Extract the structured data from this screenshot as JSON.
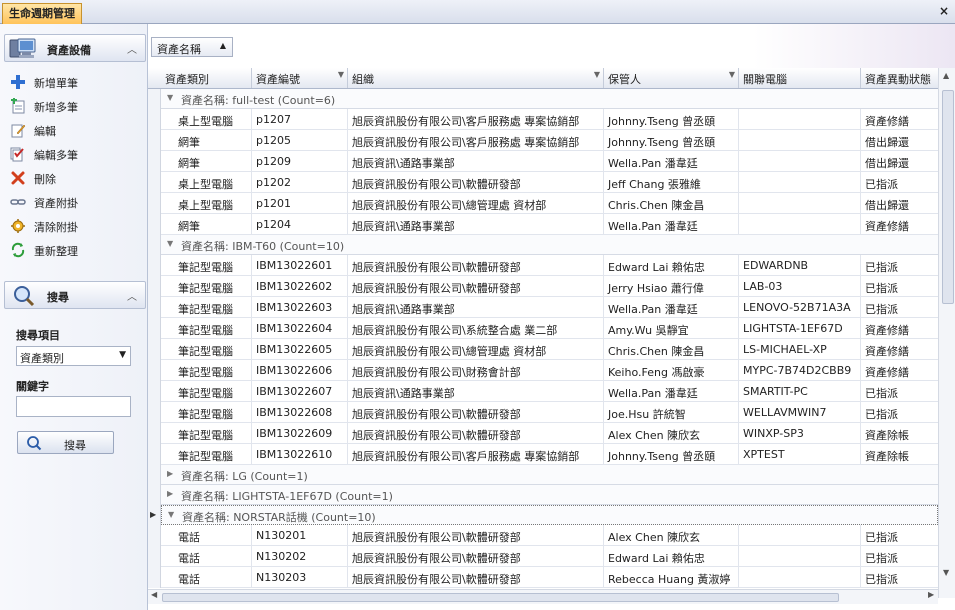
{
  "tab": {
    "label": "生命週期管理",
    "close": "×"
  },
  "sidebar": {
    "group_title": "資產設備",
    "items": [
      {
        "label": "新增單筆",
        "icon": "plus-icon"
      },
      {
        "label": "新增多筆",
        "icon": "add-multiple-icon"
      },
      {
        "label": "編輯",
        "icon": "edit-icon"
      },
      {
        "label": "編輯多筆",
        "icon": "edit-multiple-icon"
      },
      {
        "label": "刪除",
        "icon": "delete-icon"
      },
      {
        "label": "資產附掛",
        "icon": "attach-icon"
      },
      {
        "label": "清除附掛",
        "icon": "detach-icon"
      },
      {
        "label": "重新整理",
        "icon": "refresh-icon"
      }
    ],
    "search_title": "搜尋",
    "search_item_label": "搜尋項目",
    "search_item_value": "資產類別",
    "keyword_label": "關鍵字",
    "keyword_value": "",
    "search_button": "搜尋"
  },
  "group_chip": {
    "label": "資產名稱",
    "arrow": "▲"
  },
  "columns": [
    "資產類別",
    "資產編號",
    "組織",
    "保管人",
    "關聯電腦",
    "資產異動狀態"
  ],
  "groups": [
    {
      "title": "資產名稱: full-test (Count=6)",
      "expanded": true,
      "rows": [
        [
          "桌上型電腦",
          "p1207",
          "旭辰資訊股份有限公司\\客戶服務處 專案協銷部",
          "Johnny.Tseng 曾丞頤",
          "",
          "資產修繕"
        ],
        [
          "網筆",
          "p1205",
          "旭辰資訊股份有限公司\\客戶服務處 專案協銷部",
          "Johnny.Tseng 曾丞頤",
          "",
          "借出歸還"
        ],
        [
          "網筆",
          "p1209",
          "旭辰資訊\\通路事業部",
          "Wella.Pan 潘韋廷",
          "",
          "借出歸還"
        ],
        [
          "桌上型電腦",
          "p1202",
          "旭辰資訊股份有限公司\\軟體研發部",
          "Jeff Chang 張雅維",
          "",
          "已指派"
        ],
        [
          "桌上型電腦",
          "p1201",
          "旭辰資訊股份有限公司\\總管理處 資材部",
          "Chris.Chen 陳金昌",
          "",
          "借出歸還"
        ],
        [
          "網筆",
          "p1204",
          "旭辰資訊\\通路事業部",
          "Wella.Pan 潘韋廷",
          "",
          "資產修繕"
        ]
      ]
    },
    {
      "title": "資產名稱: IBM-T60 (Count=10)",
      "expanded": true,
      "rows": [
        [
          "筆記型電腦",
          "IBM13022601",
          "旭辰資訊股份有限公司\\軟體研發部",
          "Edward Lai 賴佑忠",
          "EDWARDNB",
          "已指派"
        ],
        [
          "筆記型電腦",
          "IBM13022602",
          "旭辰資訊股份有限公司\\軟體研發部",
          "Jerry Hsiao 蕭行偉",
          "LAB-03",
          "已指派"
        ],
        [
          "筆記型電腦",
          "IBM13022603",
          "旭辰資訊\\通路事業部",
          "Wella.Pan 潘韋廷",
          "LENOVO-52B71A3A",
          "已指派"
        ],
        [
          "筆記型電腦",
          "IBM13022604",
          "旭辰資訊股份有限公司\\系統整合處 業二部",
          "Amy.Wu 吳靜宜",
          "LIGHTSTA-1EF67D",
          "資產修繕"
        ],
        [
          "筆記型電腦",
          "IBM13022605",
          "旭辰資訊股份有限公司\\總管理處 資材部",
          "Chris.Chen 陳金昌",
          "LS-MICHAEL-XP",
          "資產修繕"
        ],
        [
          "筆記型電腦",
          "IBM13022606",
          "旭辰資訊股份有限公司\\財務會計部",
          "Keiho.Feng 馮啟豪",
          "MYPC-7B74D2CBB9",
          "資產修繕"
        ],
        [
          "筆記型電腦",
          "IBM13022607",
          "旭辰資訊\\通路事業部",
          "Wella.Pan 潘韋廷",
          "SMARTIT-PC",
          "已指派"
        ],
        [
          "筆記型電腦",
          "IBM13022608",
          "旭辰資訊股份有限公司\\軟體研發部",
          "Joe.Hsu 許統智",
          "WELLAVMWIN7",
          "已指派"
        ],
        [
          "筆記型電腦",
          "IBM13022609",
          "旭辰資訊股份有限公司\\軟體研發部",
          "Alex Chen 陳欣玄",
          "WINXP-SP3",
          "資產除帳"
        ],
        [
          "筆記型電腦",
          "IBM13022610",
          "旭辰資訊股份有限公司\\客戶服務處 專案協銷部",
          "Johnny.Tseng 曾丞頤",
          "XPTEST",
          "資產除帳"
        ]
      ]
    },
    {
      "title": "資產名稱: LG (Count=1)",
      "expanded": false,
      "rows": []
    },
    {
      "title": "資產名稱: LIGHTSTA-1EF67D (Count=1)",
      "expanded": false,
      "rows": []
    },
    {
      "title": "資產名稱: NORSTAR話機 (Count=10)",
      "expanded": true,
      "focused": true,
      "rows": [
        [
          "電話",
          "N130201",
          "旭辰資訊股份有限公司\\軟體研發部",
          "Alex Chen 陳欣玄",
          "",
          "已指派"
        ],
        [
          "電話",
          "N130202",
          "旭辰資訊股份有限公司\\軟體研發部",
          "Edward Lai 賴佑忠",
          "",
          "已指派"
        ],
        [
          "電話",
          "N130203",
          "旭辰資訊股份有限公司\\軟體研發部",
          "Rebecca Huang 黃淑婷",
          "",
          "已指派"
        ]
      ]
    }
  ]
}
